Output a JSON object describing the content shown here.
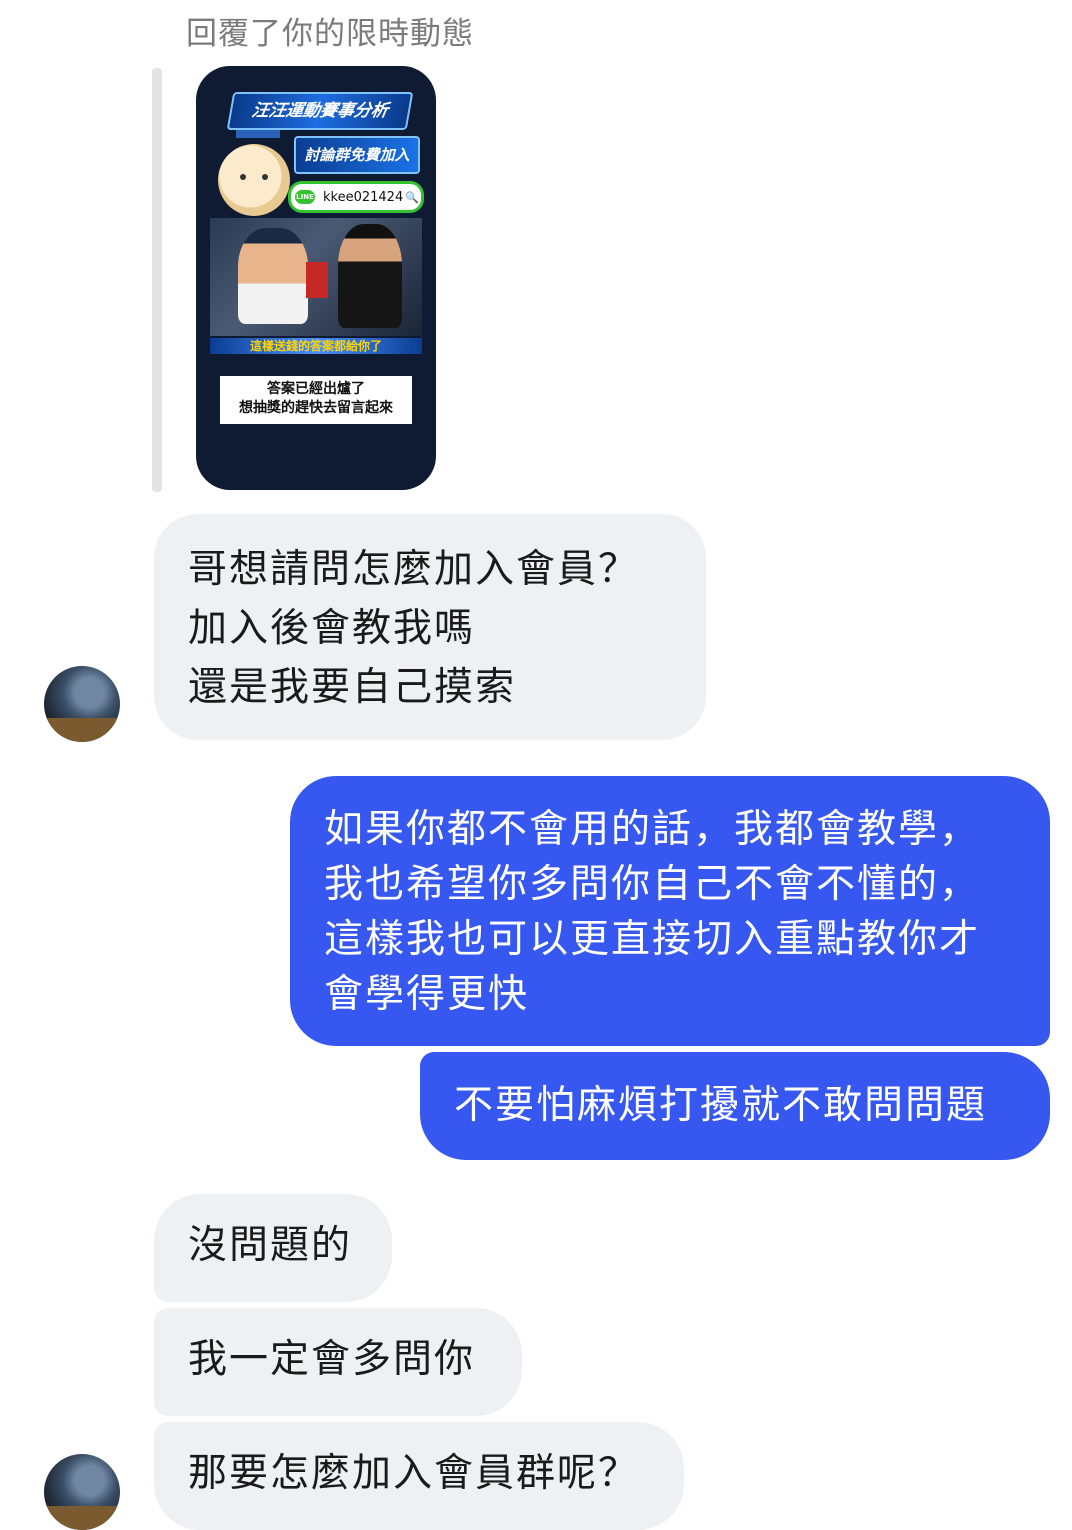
{
  "reply_caption": "回覆了你的限時動態",
  "story": {
    "banner_title": "汪汪運動賽事分析",
    "subtitle": "討論群免費加入",
    "line_badge": "LINE",
    "line_id": "kkee021424",
    "strip_text": "這樣送錢的答案都給你了",
    "answer_line1": "答案已經出爐了",
    "answer_line2": "想抽獎的趕快去留言起來"
  },
  "messages": [
    {
      "side": "incoming",
      "lines": [
        "哥想請問怎麼加入會員？",
        "加入後會教我嗎",
        "還是我要自己摸索"
      ]
    },
    {
      "side": "outgoing",
      "lines": [
        "如果你都不會用的話，我都會教學，",
        "我也希望你多問你自己不會不懂的，",
        "這樣我也可以更直接切入重點教你才",
        "會學得更快"
      ]
    },
    {
      "side": "outgoing",
      "lines": [
        "不要怕麻煩打擾就不敢問問題"
      ]
    },
    {
      "side": "incoming",
      "lines": [
        "沒問題的"
      ]
    },
    {
      "side": "incoming",
      "lines": [
        "我一定會多問你"
      ]
    },
    {
      "side": "incoming",
      "lines": [
        "那要怎麼加入會員群呢？"
      ]
    }
  ]
}
